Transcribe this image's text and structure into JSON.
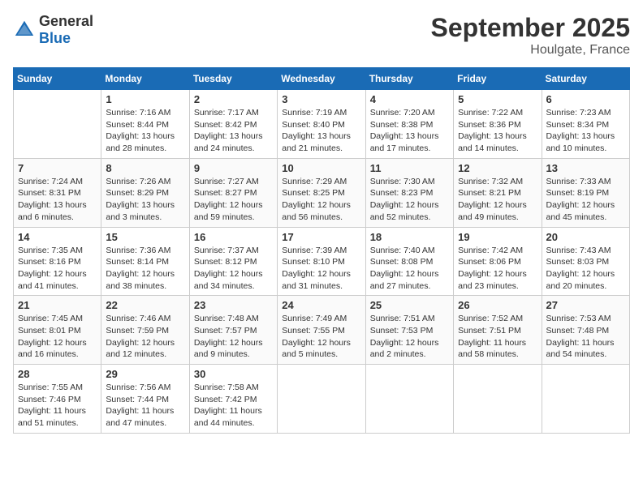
{
  "header": {
    "logo_general": "General",
    "logo_blue": "Blue",
    "month": "September 2025",
    "location": "Houlgate, France"
  },
  "days_of_week": [
    "Sunday",
    "Monday",
    "Tuesday",
    "Wednesday",
    "Thursday",
    "Friday",
    "Saturday"
  ],
  "weeks": [
    [
      null,
      {
        "day": 1,
        "sunrise": "7:16 AM",
        "sunset": "8:44 PM",
        "daylight": "13 hours and 28 minutes."
      },
      {
        "day": 2,
        "sunrise": "7:17 AM",
        "sunset": "8:42 PM",
        "daylight": "13 hours and 24 minutes."
      },
      {
        "day": 3,
        "sunrise": "7:19 AM",
        "sunset": "8:40 PM",
        "daylight": "13 hours and 21 minutes."
      },
      {
        "day": 4,
        "sunrise": "7:20 AM",
        "sunset": "8:38 PM",
        "daylight": "13 hours and 17 minutes."
      },
      {
        "day": 5,
        "sunrise": "7:22 AM",
        "sunset": "8:36 PM",
        "daylight": "13 hours and 14 minutes."
      },
      {
        "day": 6,
        "sunrise": "7:23 AM",
        "sunset": "8:34 PM",
        "daylight": "13 hours and 10 minutes."
      }
    ],
    [
      {
        "day": 7,
        "sunrise": "7:24 AM",
        "sunset": "8:31 PM",
        "daylight": "13 hours and 6 minutes."
      },
      {
        "day": 8,
        "sunrise": "7:26 AM",
        "sunset": "8:29 PM",
        "daylight": "13 hours and 3 minutes."
      },
      {
        "day": 9,
        "sunrise": "7:27 AM",
        "sunset": "8:27 PM",
        "daylight": "12 hours and 59 minutes."
      },
      {
        "day": 10,
        "sunrise": "7:29 AM",
        "sunset": "8:25 PM",
        "daylight": "12 hours and 56 minutes."
      },
      {
        "day": 11,
        "sunrise": "7:30 AM",
        "sunset": "8:23 PM",
        "daylight": "12 hours and 52 minutes."
      },
      {
        "day": 12,
        "sunrise": "7:32 AM",
        "sunset": "8:21 PM",
        "daylight": "12 hours and 49 minutes."
      },
      {
        "day": 13,
        "sunrise": "7:33 AM",
        "sunset": "8:19 PM",
        "daylight": "12 hours and 45 minutes."
      }
    ],
    [
      {
        "day": 14,
        "sunrise": "7:35 AM",
        "sunset": "8:16 PM",
        "daylight": "12 hours and 41 minutes."
      },
      {
        "day": 15,
        "sunrise": "7:36 AM",
        "sunset": "8:14 PM",
        "daylight": "12 hours and 38 minutes."
      },
      {
        "day": 16,
        "sunrise": "7:37 AM",
        "sunset": "8:12 PM",
        "daylight": "12 hours and 34 minutes."
      },
      {
        "day": 17,
        "sunrise": "7:39 AM",
        "sunset": "8:10 PM",
        "daylight": "12 hours and 31 minutes."
      },
      {
        "day": 18,
        "sunrise": "7:40 AM",
        "sunset": "8:08 PM",
        "daylight": "12 hours and 27 minutes."
      },
      {
        "day": 19,
        "sunrise": "7:42 AM",
        "sunset": "8:06 PM",
        "daylight": "12 hours and 23 minutes."
      },
      {
        "day": 20,
        "sunrise": "7:43 AM",
        "sunset": "8:03 PM",
        "daylight": "12 hours and 20 minutes."
      }
    ],
    [
      {
        "day": 21,
        "sunrise": "7:45 AM",
        "sunset": "8:01 PM",
        "daylight": "12 hours and 16 minutes."
      },
      {
        "day": 22,
        "sunrise": "7:46 AM",
        "sunset": "7:59 PM",
        "daylight": "12 hours and 12 minutes."
      },
      {
        "day": 23,
        "sunrise": "7:48 AM",
        "sunset": "7:57 PM",
        "daylight": "12 hours and 9 minutes."
      },
      {
        "day": 24,
        "sunrise": "7:49 AM",
        "sunset": "7:55 PM",
        "daylight": "12 hours and 5 minutes."
      },
      {
        "day": 25,
        "sunrise": "7:51 AM",
        "sunset": "7:53 PM",
        "daylight": "12 hours and 2 minutes."
      },
      {
        "day": 26,
        "sunrise": "7:52 AM",
        "sunset": "7:51 PM",
        "daylight": "11 hours and 58 minutes."
      },
      {
        "day": 27,
        "sunrise": "7:53 AM",
        "sunset": "7:48 PM",
        "daylight": "11 hours and 54 minutes."
      }
    ],
    [
      {
        "day": 28,
        "sunrise": "7:55 AM",
        "sunset": "7:46 PM",
        "daylight": "11 hours and 51 minutes."
      },
      {
        "day": 29,
        "sunrise": "7:56 AM",
        "sunset": "7:44 PM",
        "daylight": "11 hours and 47 minutes."
      },
      {
        "day": 30,
        "sunrise": "7:58 AM",
        "sunset": "7:42 PM",
        "daylight": "11 hours and 44 minutes."
      },
      null,
      null,
      null,
      null
    ]
  ]
}
